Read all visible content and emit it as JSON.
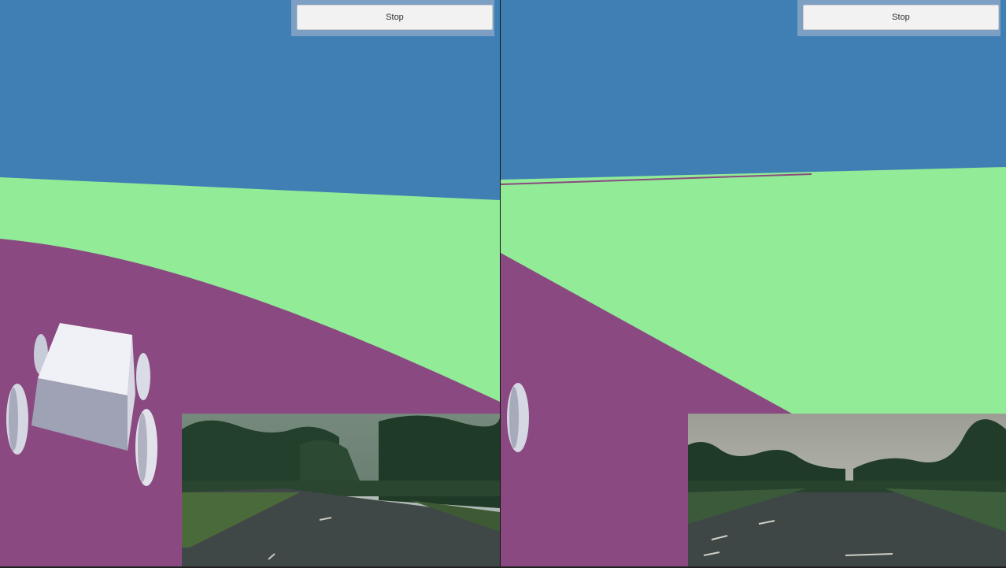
{
  "left_view": {
    "stop_button_label": "Stop",
    "colors": {
      "sky": "#3f7fb4",
      "grass": "#92eb97",
      "road": "#8a4a81",
      "car_body": "#e8e8f0"
    }
  },
  "right_view": {
    "stop_button_label": "Stop",
    "colors": {
      "sky": "#3f7fb4",
      "grass": "#92eb97",
      "road": "#8a4a81"
    }
  },
  "camera_feeds": {
    "left": {
      "description_icon": "road-camera-image"
    },
    "right": {
      "description_icon": "road-camera-image"
    }
  }
}
